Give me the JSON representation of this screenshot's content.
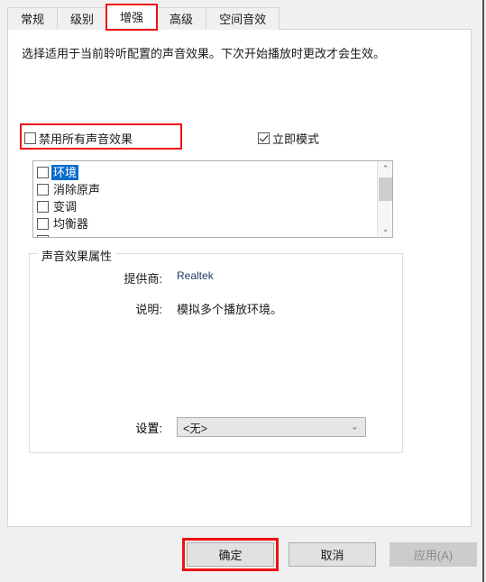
{
  "tabs": [
    {
      "label": "常规",
      "active": false
    },
    {
      "label": "级别",
      "active": false
    },
    {
      "label": "增强",
      "active": true
    },
    {
      "label": "高级",
      "active": false
    },
    {
      "label": "空间音效",
      "active": false
    }
  ],
  "content": {
    "description": "选择适用于当前聆听配置的声音效果。下次开始播放时更改才会生效。",
    "disable_all_effects": {
      "label": "禁用所有声音效果",
      "checked": false
    },
    "immediate_mode": {
      "label": "立即模式",
      "checked": true
    }
  },
  "effects_list": [
    {
      "label": "环境",
      "checked": false,
      "selected": true
    },
    {
      "label": "消除原声",
      "checked": false,
      "selected": false
    },
    {
      "label": "变调",
      "checked": false,
      "selected": false
    },
    {
      "label": "均衡器",
      "checked": false,
      "selected": false
    }
  ],
  "properties": {
    "group_title": "声音效果属性",
    "vendor_label": "提供商:",
    "vendor_value": "Realtek",
    "description_label": "说明:",
    "description_value": "模拟多个播放环境。",
    "settings_label": "设置:",
    "settings_value": "<无>"
  },
  "footer": {
    "ok": "确定",
    "cancel": "取消",
    "apply": "应用(A)"
  },
  "icons": {
    "chevron_up": "⌃",
    "chevron_down": "⌄",
    "combo_chevron": "⌄"
  },
  "colors": {
    "selection_blue": "#0a6ccd",
    "highlight_red": "#ee1111",
    "vendor_text": "#1f3864",
    "dialog_bg": "#f0f0f0",
    "panel_bg": "#ffffff"
  }
}
